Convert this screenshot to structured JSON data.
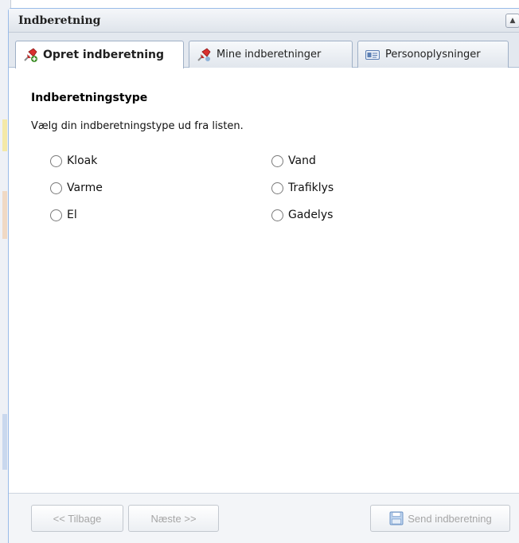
{
  "panel": {
    "title": "Indberetning",
    "collapse_glyph": "▲"
  },
  "tabs": [
    {
      "label": "Opret indberetning",
      "icon": "pushpin-icon",
      "active": true
    },
    {
      "label": "Mine indberetninger",
      "icon": "pushpin-icon",
      "active": false
    },
    {
      "label": "Personoplysninger",
      "icon": "id-card-icon",
      "active": false
    }
  ],
  "content": {
    "section_title": "Indberetningstype",
    "hint": "Vælg din indberetningstype ud fra listen.",
    "options": [
      {
        "label": "Kloak",
        "selected": false
      },
      {
        "label": "Vand",
        "selected": false
      },
      {
        "label": "Varme",
        "selected": false
      },
      {
        "label": "Trafiklys",
        "selected": false
      },
      {
        "label": "El",
        "selected": false
      },
      {
        "label": "Gadelys",
        "selected": false
      }
    ]
  },
  "footer": {
    "back_label": "<< Tilbage",
    "next_label": "Næste >>",
    "send_label": "Send indberetning"
  },
  "colors": {
    "panel_border": "#99bbe8",
    "pin_red": "#d8302f",
    "pin_green": "#3f8f2a",
    "disabled_text": "#a6a6a6"
  }
}
